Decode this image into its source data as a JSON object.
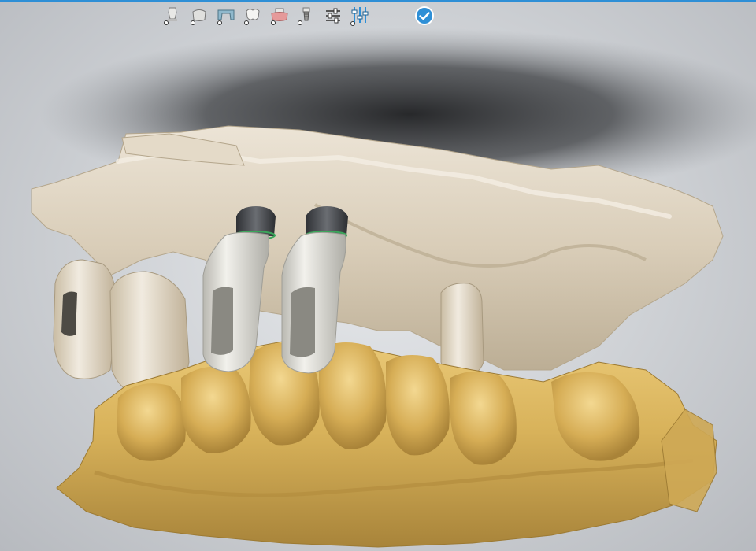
{
  "app": {
    "accent_color": "#2e8fd6",
    "background_color": "#cdd0d4"
  },
  "toolbar": {
    "tools": [
      {
        "icon": "abutment-icon",
        "active": false
      },
      {
        "icon": "coping-icon",
        "active": false
      },
      {
        "icon": "bridge-icon",
        "active": false
      },
      {
        "icon": "crown-icon",
        "active": false
      },
      {
        "icon": "gingiva-icon",
        "active": false
      },
      {
        "icon": "implant-icon",
        "active": false
      },
      {
        "icon": "settings-sliders-icon",
        "active": false
      },
      {
        "icon": "alignment-sliders-icon",
        "active": true
      }
    ],
    "confirm_icon": "check-circle-icon",
    "confirm_color": "#2e8fd6"
  },
  "scene": {
    "upper_model_color": "#d9cdb8",
    "lower_model_color": "#d8b25a",
    "abutment_color": "#d7d6cf",
    "implant_color": "#4a4d52"
  }
}
